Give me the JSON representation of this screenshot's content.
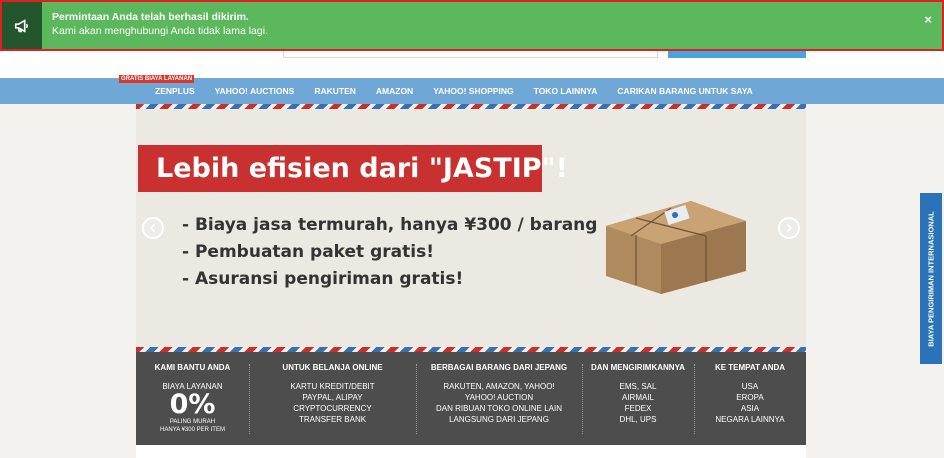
{
  "notification": {
    "title": "Permintaan Anda telah berhasil dikirim.",
    "message": "Kami akan menghubungi Anda tidak lama lagi.",
    "close": "×",
    "icon": "megaphone-icon",
    "bg_color": "#5cb85c"
  },
  "nav": {
    "badge": "GRATIS BIAYA LAYANAN",
    "items": [
      "ZENPLUS",
      "YAHOO! AUCTIONS",
      "RAKUTEN",
      "AMAZON",
      "YAHOO! SHOPPING",
      "TOKO LAINNYA",
      "CARIKAN BARANG UNTUK SAYA"
    ]
  },
  "hero": {
    "title": "Lebih efisien dari \"JASTIP\"!",
    "bullets": [
      "- Biaya jasa termurah, hanya ¥300 / barang",
      "- Pembuatan paket gratis!",
      "- Asuransi pengiriman gratis!"
    ],
    "prev_icon": "chevron-left-icon",
    "next_icon": "chevron-right-icon",
    "accent_color": "#c93030"
  },
  "info": {
    "columns": [
      {
        "heading": "KAMI BANTU ANDA",
        "lines": [
          "BIAYA LAYANAN"
        ],
        "big": "0%",
        "small": [
          "PALING MURAH",
          "HANYA ¥300 PER ITEM"
        ]
      },
      {
        "heading": "UNTUK BELANJA ONLINE",
        "lines": [
          "KARTU KREDIT/DEBIT",
          "PAYPAL, ALIPAY",
          "CRYPTOCURRENCY",
          "TRANSFER BANK"
        ]
      },
      {
        "heading": "BERBAGAI BARANG DARI JEPANG",
        "lines": [
          "RAKUTEN, AMAZON, YAHOO!",
          "YAHOO! AUCTION",
          "DAN RIBUAN TOKO ONLINE LAIN",
          "LANGSUNG DARI JEPANG"
        ]
      },
      {
        "heading": "DAN MENGIRIMKANNYA",
        "lines": [
          "EMS, SAL",
          "AIRMAIL",
          "FEDEX",
          "DHL, UPS"
        ]
      },
      {
        "heading": "KE TEMPAT ANDA",
        "lines": [
          "USA",
          "EROPA",
          "ASIA",
          "NEGARA LAINNYA"
        ]
      }
    ]
  },
  "side_tab": {
    "label": "BIAYA PENGIRIMAN INTERNASIONAL",
    "color": "#2b73b8"
  }
}
